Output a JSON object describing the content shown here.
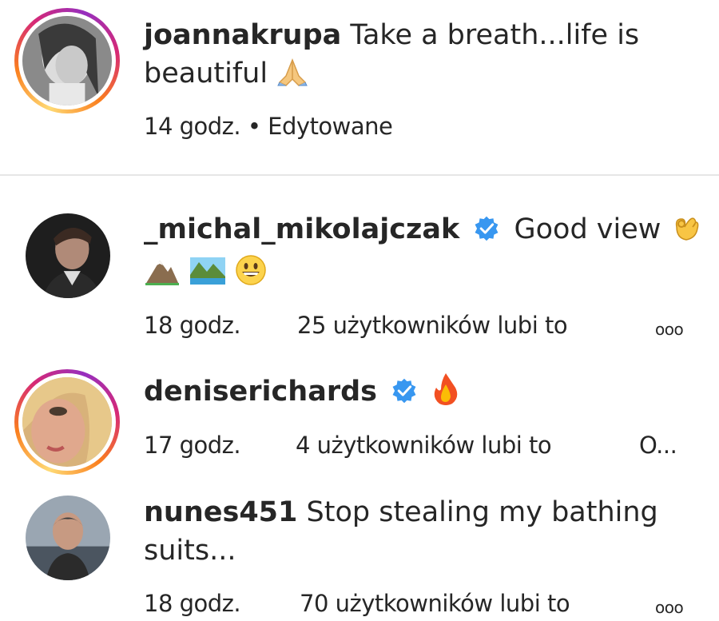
{
  "caption": {
    "username": "joannakrupa",
    "text": "Take a breath...life is beautiful",
    "emoji": "folded-hands",
    "time": "14 godz.",
    "separator": "•",
    "edited": "Edytowane"
  },
  "comments": [
    {
      "username": "_michal_mikolajczak",
      "verified": true,
      "text": "Good view",
      "emojis": [
        "ok-hand",
        "mountain",
        "national-park",
        "grinning-face"
      ],
      "time": "18 godz.",
      "likes": "25 użytkowników lubi to",
      "more": "ooo"
    },
    {
      "username": "deniserichards",
      "verified": true,
      "text": "",
      "emojis": [
        "fire"
      ],
      "time": "17 godz.",
      "likes": "4 użytkowników lubi to",
      "more": "O..."
    },
    {
      "username": "nunes451",
      "verified": false,
      "text": "Stop stealing my bathing suits...",
      "emojis": [],
      "time": "18 godz.",
      "likes": "70 użytkowników lubi to",
      "more": "ooo"
    }
  ],
  "colors": {
    "text": "#262626",
    "verified": "#3897f0",
    "divider": "#e6e6e6"
  }
}
